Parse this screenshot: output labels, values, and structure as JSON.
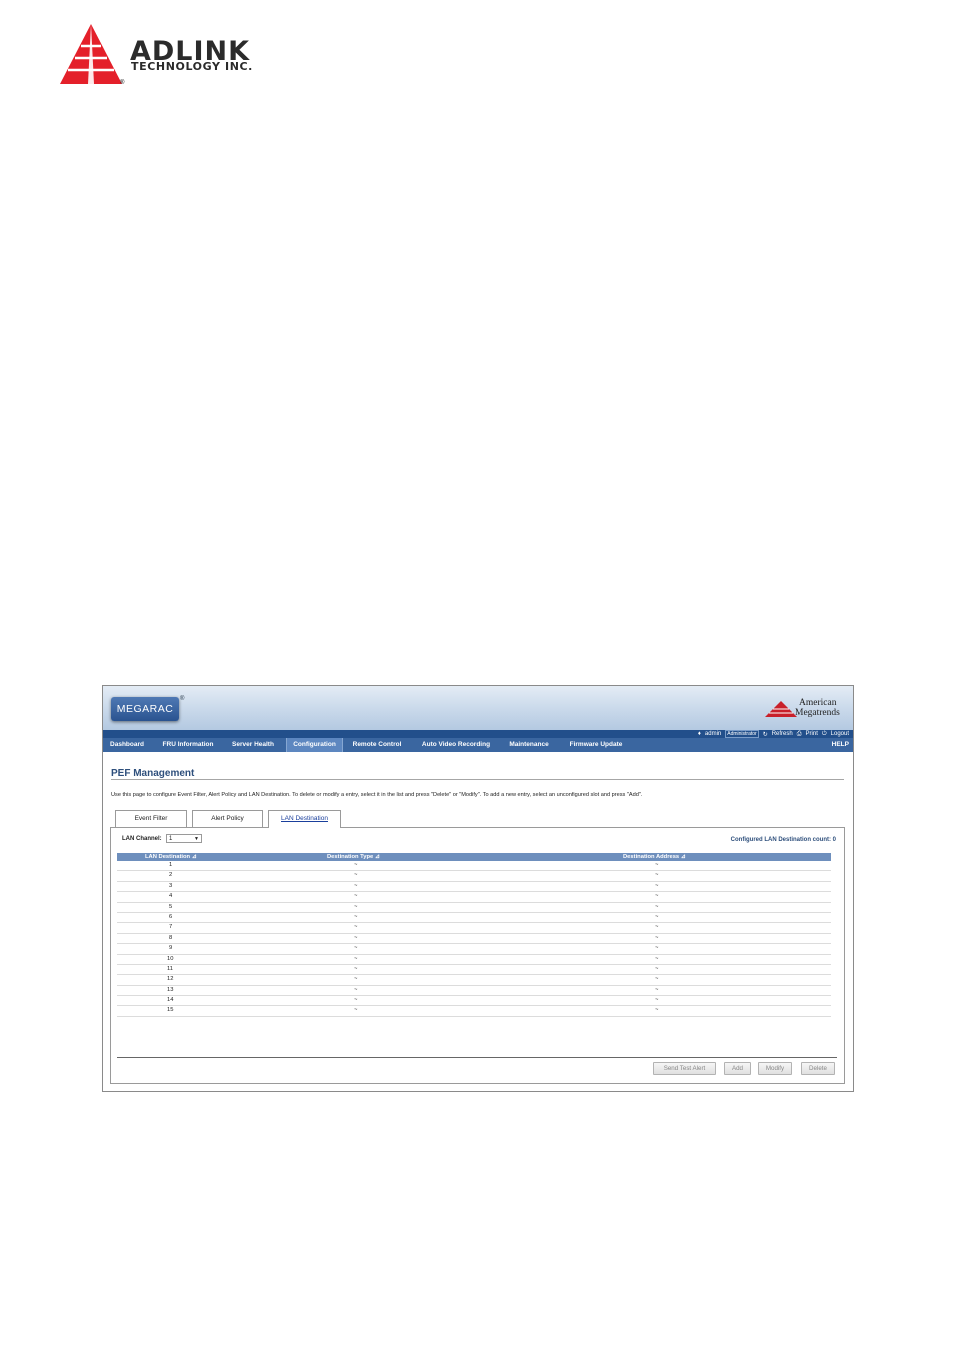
{
  "logo": {
    "brand": "ADLINK",
    "sub": "TECHNOLOGY INC.",
    "registered": "®"
  },
  "header": {
    "product": "MEGARAC",
    "product_mark": "®",
    "vendor_line1": "American",
    "vendor_line2": "Megatrends"
  },
  "userbar": {
    "user": "admin",
    "role": "Administrator",
    "refresh": "Refresh",
    "print": "Print",
    "logout": "Logout"
  },
  "nav": {
    "tabs": [
      "Dashboard",
      "FRU Information",
      "Server Health",
      "Configuration",
      "Remote Control",
      "Auto Video Recording",
      "Maintenance",
      "Firmware Update"
    ],
    "active": "Configuration",
    "help": "HELP"
  },
  "page": {
    "title": "PEF Management",
    "description": "Use this page to configure Event Filter, Alert Policy and LAN Destination. To delete or modify a entry, select it in the list and press \"Delete\" or \"Modify\". To add a new entry, select an unconfigured slot and press \"Add\".",
    "tabs": [
      "Event Filter",
      "Alert Policy",
      "LAN Destination"
    ],
    "active_tab": "LAN Destination"
  },
  "lan": {
    "channel_label": "LAN Channel:",
    "channel_value": "1",
    "count_label": "Configured LAN Destination count: 0"
  },
  "table": {
    "headers": [
      "LAN Destination",
      "Destination Type",
      "Destination Address"
    ],
    "sort_glyph": "⊿",
    "rows": [
      [
        "1",
        "~",
        "~"
      ],
      [
        "2",
        "~",
        "~"
      ],
      [
        "3",
        "~",
        "~"
      ],
      [
        "4",
        "~",
        "~"
      ],
      [
        "5",
        "~",
        "~"
      ],
      [
        "6",
        "~",
        "~"
      ],
      [
        "7",
        "~",
        "~"
      ],
      [
        "8",
        "~",
        "~"
      ],
      [
        "9",
        "~",
        "~"
      ],
      [
        "10",
        "~",
        "~"
      ],
      [
        "11",
        "~",
        "~"
      ],
      [
        "12",
        "~",
        "~"
      ],
      [
        "13",
        "~",
        "~"
      ],
      [
        "14",
        "~",
        "~"
      ],
      [
        "15",
        "~",
        "~"
      ]
    ]
  },
  "buttons": {
    "send_test": "Send Test Alert",
    "add": "Add",
    "modify": "Modify",
    "delete": "Delete"
  },
  "colors": {
    "logo_red": "#e4202a",
    "nav_bg": "#3a66a0",
    "header_bar": "#224f8b",
    "title": "#2e4f7c"
  },
  "icons": [
    "user-icon",
    "refresh-icon",
    "print-icon",
    "logout-icon",
    "dropdown-arrow-icon",
    "sort-icon"
  ]
}
